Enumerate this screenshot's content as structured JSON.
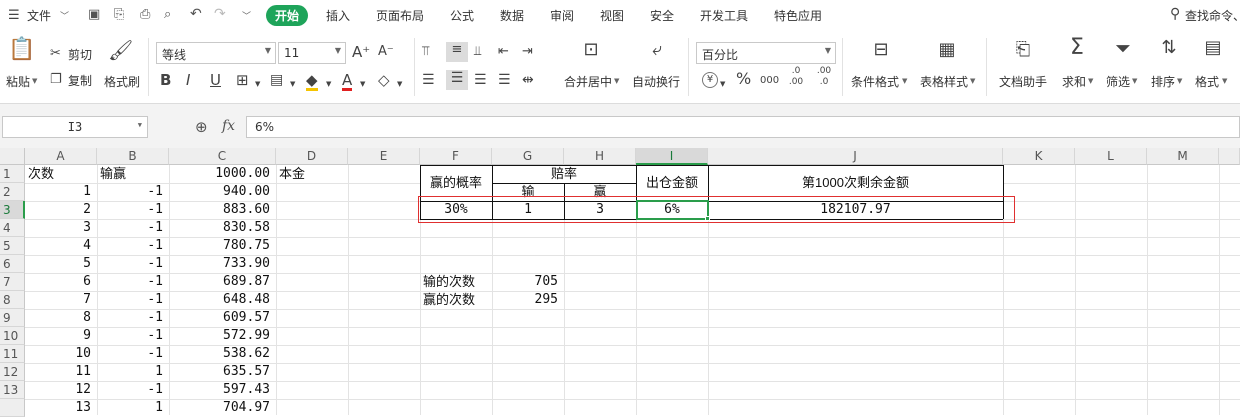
{
  "menubar": {
    "file": "文件",
    "items": [
      "开始",
      "插入",
      "页面布局",
      "公式",
      "数据",
      "审阅",
      "视图",
      "安全",
      "开发工具",
      "特色应用"
    ],
    "search": "查找命令、"
  },
  "ribbon": {
    "paste": "粘贴",
    "cut": "剪切",
    "copy": "复制",
    "format_painter": "格式刷",
    "font_name": "等线",
    "font_size": "11",
    "merge_center": "合并居中",
    "wrap_text": "自动换行",
    "number_format": "百分比",
    "percent_symbol": "%",
    "currency_symbol": "¥",
    "thousands": "000",
    "inc_decimal": ".0 .00",
    "dec_decimal": ".00 .0",
    "cond_format": "条件格式",
    "table_style": "表格样式",
    "doc_assistant": "文档助手",
    "sum": "求和",
    "filter": "筛选",
    "sort": "排序",
    "format": "格式"
  },
  "formula_bar": {
    "cell_ref": "I3",
    "fx_label": "fx",
    "content": "6%"
  },
  "grid": {
    "columns": [
      "A",
      "B",
      "C",
      "D",
      "E",
      "F",
      "G",
      "H",
      "I",
      "J",
      "K",
      "L",
      "M"
    ],
    "rows": [
      "1",
      "2",
      "3",
      "4",
      "5",
      "6",
      "7",
      "8",
      "9",
      "10",
      "11",
      "12",
      "13"
    ],
    "colA": [
      "次数",
      "1",
      "2",
      "3",
      "4",
      "5",
      "6",
      "7",
      "8",
      "9",
      "10",
      "11",
      "12",
      "13"
    ],
    "colB": [
      "输赢",
      "-1",
      "-1",
      "-1",
      "-1",
      "-1",
      "-1",
      "-1",
      "-1",
      "-1",
      "-1",
      "1",
      "-1",
      "1"
    ],
    "colC": [
      "1000.00",
      "940.00",
      "883.60",
      "830.58",
      "780.75",
      "733.90",
      "689.87",
      "648.48",
      "609.57",
      "572.99",
      "538.62",
      "635.57",
      "597.43",
      "704.97"
    ],
    "D1": "本金",
    "table": {
      "F1": "赢的概率",
      "G1": "赔率",
      "G2": "输",
      "H2": "赢",
      "I1": "出仓金额",
      "J1": "第1000次剩余金额",
      "F3": "30%",
      "G3": "1",
      "H3": "3",
      "I3": "6%",
      "J3": "182107.97"
    },
    "F7": "输的次数",
    "G7": "705",
    "F8": "赢的次数",
    "G8": "295"
  }
}
